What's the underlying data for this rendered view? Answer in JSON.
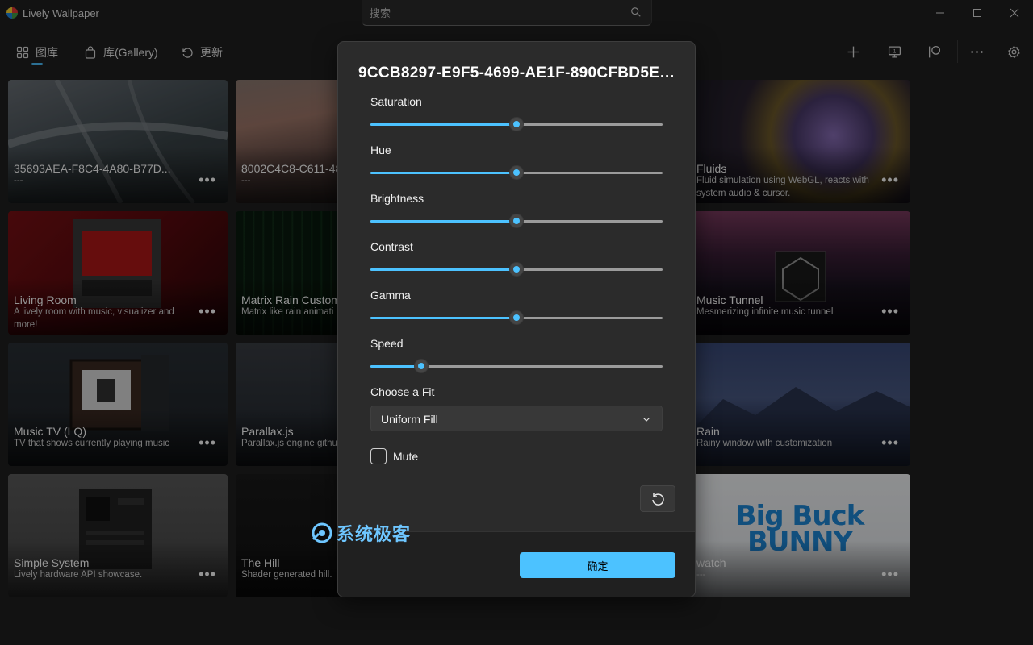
{
  "window": {
    "app_title": "Lively Wallpaper",
    "search_placeholder": "搜索"
  },
  "nav": {
    "items": [
      {
        "label": "图库",
        "icon": "grid-icon",
        "selected": true
      },
      {
        "label": "库(Gallery)",
        "icon": "shopping-bag-icon"
      },
      {
        "label": "更新",
        "icon": "refresh-icon"
      }
    ],
    "tools": [
      "plus-icon",
      "monitor-icon",
      "patreon-icon",
      "more-icon",
      "gear-icon"
    ]
  },
  "cards": [
    {
      "title": "35693AEA-F8C4-4A80-B77D...",
      "desc": "---"
    },
    {
      "title": "8002C4C8-C611-48",
      "desc": "---"
    },
    {
      "title": "Fluids",
      "desc": "Fluid simulation using WebGL, reacts with system audio & cursor."
    },
    {
      "title": "Living Room",
      "desc": "A lively room with music, visualizer and more!"
    },
    {
      "title": "Matrix Rain Custom",
      "desc": "Matrix like rain animati Canvas."
    },
    {
      "title": "Music Tunnel",
      "desc": "Mesmerizing infinite music tunnel"
    },
    {
      "title": "Music TV (LQ)",
      "desc": "TV that shows currently playing music"
    },
    {
      "title": "Parallax.js",
      "desc": "Parallax.js engine githu"
    },
    {
      "title": "Rain",
      "desc": "Rainy window with customization"
    },
    {
      "title": "Simple System",
      "desc": "Lively hardware API showcase."
    },
    {
      "title": "The Hill",
      "desc": "Shader generated hill."
    },
    {
      "title": "watch",
      "desc": "---",
      "logo": "Big Buck BUNNY"
    }
  ],
  "dialog": {
    "title": "9CCB8297-E9F5-4699-AE1F-890CFBD5E29...",
    "sliders": [
      {
        "label": "Saturation",
        "value": 0.5
      },
      {
        "label": "Hue",
        "value": 0.5
      },
      {
        "label": "Brightness",
        "value": 0.5
      },
      {
        "label": "Contrast",
        "value": 0.5
      },
      {
        "label": "Gamma",
        "value": 0.5
      },
      {
        "label": "Speed",
        "value": 0.175
      }
    ],
    "fit_label": "Choose a Fit",
    "fit_value": "Uniform Fill",
    "mute_label": "Mute",
    "mute_checked": false,
    "ok_label": "确定"
  },
  "watermark": "系统极客",
  "colors": {
    "accent": "#4cc2ff",
    "background": "#1f1f1f",
    "dialog": "#2b2b2b"
  }
}
